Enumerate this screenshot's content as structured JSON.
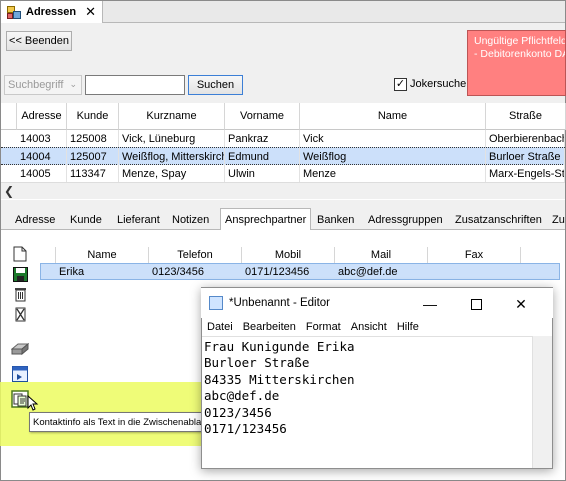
{
  "window_tab": {
    "title": "Adressen",
    "close": "✕"
  },
  "top": {
    "back_button": "<< Beenden",
    "warning": {
      "line1": "Ungültige Pflichtfelde",
      "line2": "-  Debitorenkonto DAV"
    },
    "search_mode": "Suchbegriff",
    "search_value": "",
    "search_button": "Suchen",
    "jokersuche": {
      "label": "Jokersuche",
      "checked": true
    }
  },
  "address_grid": {
    "columns": [
      "Adresse",
      "Kunde",
      "Kurzname",
      "Vorname",
      "Name",
      "Straße"
    ],
    "rows": [
      [
        "14003",
        "125008",
        "Vick, Lüneburg",
        "Pankraz",
        "Vick",
        "Oberbierenbach"
      ],
      [
        "14004",
        "125007",
        "Weißflog, Mitterskirch",
        "Edmund",
        "Weißflog",
        "Burloer Straße"
      ],
      [
        "14005",
        "113347",
        "Menze, Spay",
        "Ulwin",
        "Menze",
        "Marx-Engels-Str"
      ]
    ],
    "selected_row": 1
  },
  "sub_tabs": [
    "Adresse",
    "Kunde",
    "Lieferant",
    "Notizen",
    "Ansprechpartner",
    "Banken",
    "Adressgruppen",
    "Zusatzanschriften",
    "Zu"
  ],
  "active_sub_tab": "Ansprechpartner",
  "contact_grid": {
    "columns": [
      "Name",
      "Telefon",
      "Mobil",
      "Mail",
      "Fax"
    ],
    "rows": [
      [
        "Erika",
        "0123/3456",
        "0171/123456",
        "abc@def.de",
        ""
      ]
    ]
  },
  "toolbar_icons": [
    "new-document-icon",
    "save-icon",
    "delete-icon",
    "delete-all-icon",
    "print-icon",
    "export-icon",
    "copy-contact-icon"
  ],
  "tooltip": "Kontaktinfo als Text in die Zwischenablage",
  "notepad": {
    "title": "*Unbenannt - Editor",
    "menu": [
      "Datei",
      "Bearbeiten",
      "Format",
      "Ansicht",
      "Hilfe"
    ],
    "content": "Frau Kunigunde Erika\nBurloer Straße\n84335 Mitterskirchen\nabc@def.de\n0123/3456\n0171/123456"
  }
}
